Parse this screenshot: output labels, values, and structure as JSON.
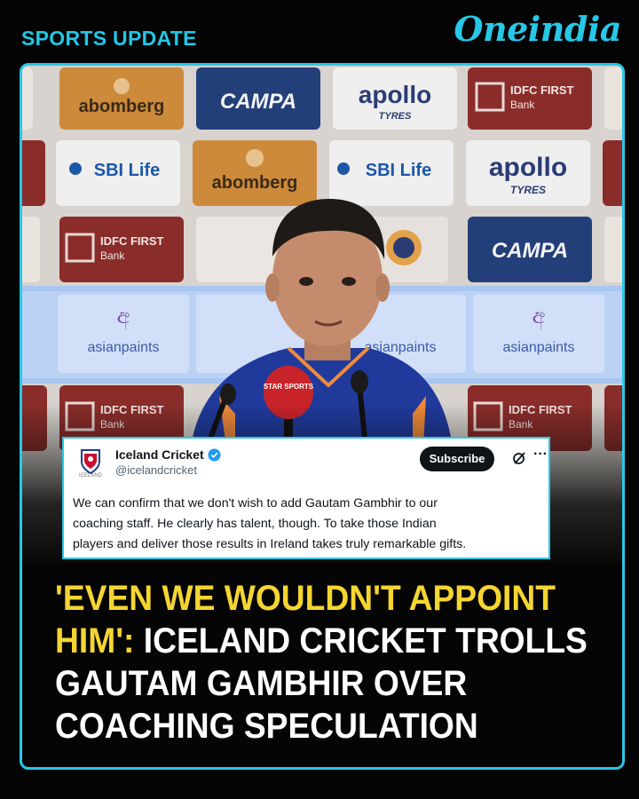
{
  "header": {
    "section_label": "SPORTS UPDATE",
    "brand": "Oneindia",
    "accent_color": "#27c8e7"
  },
  "backdrop": {
    "sponsor_panels": [
      "abomberg",
      "CAMPA",
      "apollo TYRES",
      "IDFC FIRST Bank",
      "SBI Life",
      "asianpaints"
    ],
    "microphone_label": "STAR SPORTS"
  },
  "tweet": {
    "account_name": "Iceland Cricket",
    "handle": "@icelandcricket",
    "avatar_caption": "ICELAND",
    "subscribe_label": "Subscribe",
    "more_label": "···",
    "body_lines": [
      "We can confirm that we don't wish to add Gautam Gambhir to our",
      "coaching staff. He clearly has talent, though. To take those Indian",
      "players and deliver those results in Ireland takes truly remarkable gifts."
    ]
  },
  "headline": {
    "line1_highlight": "'EVEN WE WOULDN'T APPOINT",
    "line2_highlight": "HIM':",
    "line2_rest": " ICELAND CRICKET TROLLS",
    "line3": "GAUTAM GAMBHIR OVER",
    "line4": "COACHING SPECULATION",
    "highlight_color": "#f5d531"
  }
}
